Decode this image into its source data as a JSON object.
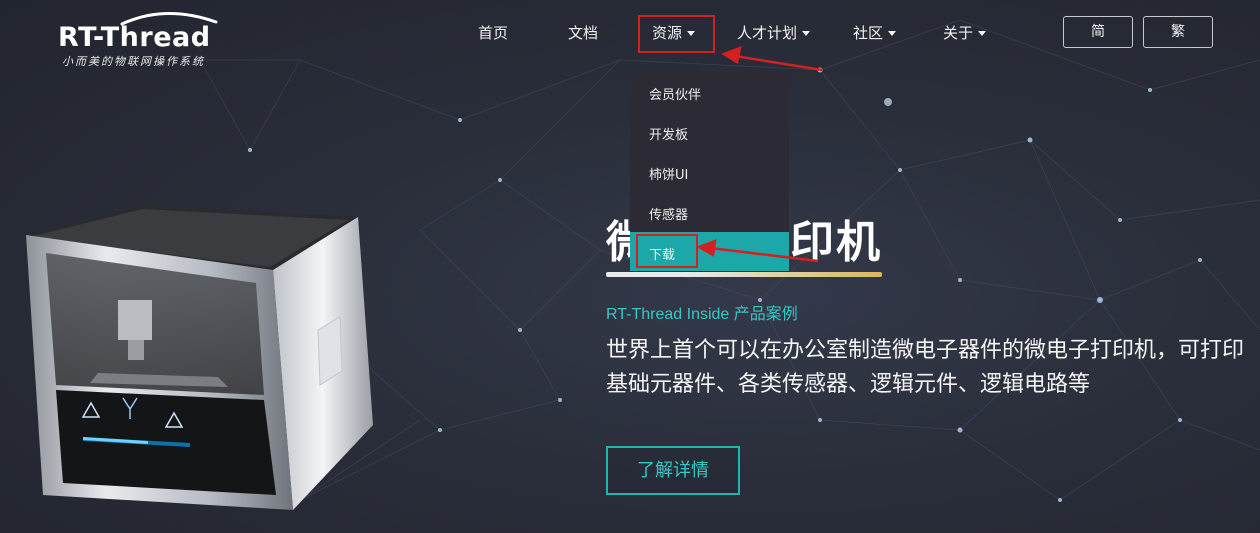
{
  "logo": {
    "title": "RT-Thread",
    "subtitle": "小而美的物联网操作系统"
  },
  "nav": {
    "items": [
      {
        "label": "首页",
        "has_caret": false
      },
      {
        "label": "文档",
        "has_caret": false
      },
      {
        "label": "资源",
        "has_caret": true
      },
      {
        "label": "人才计划",
        "has_caret": true
      },
      {
        "label": "社区",
        "has_caret": true
      },
      {
        "label": "关于",
        "has_caret": true
      }
    ],
    "lang_simplified": "简",
    "lang_traditional": "繁"
  },
  "dropdown": {
    "items": [
      "会员伙伴",
      "开发板",
      "柿饼UI",
      "传感器",
      "下载"
    ],
    "active": "下载"
  },
  "hero": {
    "title": "微电子打印机",
    "subtitle": "RT-Thread Inside 产品案例",
    "description_line1": "世界上首个可以在办公室制造微电子器件的微电子打印机，可打印",
    "description_line2": "基础元器件、各类传感器、逻辑元件、逻辑电路等",
    "button": "了解详情"
  },
  "colors": {
    "accent_teal": "#1ca7a8",
    "annotation_red": "#d42020",
    "background": "#262a35"
  }
}
